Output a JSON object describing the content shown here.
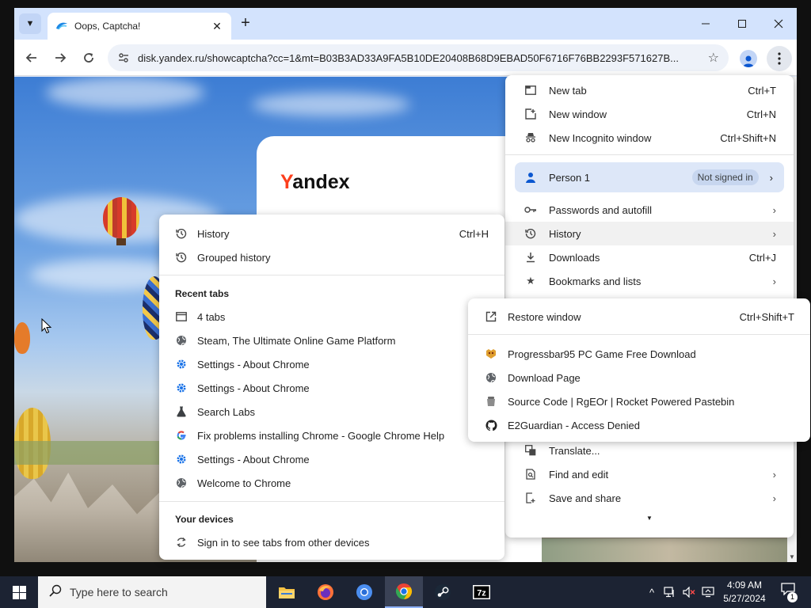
{
  "browser": {
    "tab_title": "Oops, Captcha!",
    "url": "disk.yandex.ru/showcaptcha?cc=1&mt=B03B3AD33A9FA5B10DE20408B68D9EBAD50F6716F76BB2293F571627B...",
    "close_glyph": "✕",
    "new_tab_glyph": "+"
  },
  "page": {
    "yandex_logo_y": "Y",
    "yandex_logo_rest": "andex"
  },
  "main_menu": {
    "new_tab": {
      "label": "New tab",
      "shortcut": "Ctrl+T"
    },
    "new_window": {
      "label": "New window",
      "shortcut": "Ctrl+N"
    },
    "new_incognito": {
      "label": "New Incognito window",
      "shortcut": "Ctrl+Shift+N"
    },
    "person": {
      "label": "Person 1",
      "badge": "Not signed in"
    },
    "passwords": {
      "label": "Passwords and autofill"
    },
    "history": {
      "label": "History"
    },
    "downloads": {
      "label": "Downloads",
      "shortcut": "Ctrl+J"
    },
    "bookmarks": {
      "label": "Bookmarks and lists"
    },
    "translate": {
      "label": "Translate..."
    },
    "find_edit": {
      "label": "Find and edit"
    },
    "save_share": {
      "label": "Save and share"
    }
  },
  "history_menu": {
    "history": {
      "label": "History",
      "shortcut": "Ctrl+H"
    },
    "grouped": {
      "label": "Grouped history"
    },
    "recent_tabs_heading": "Recent tabs",
    "recent_tabs": [
      {
        "label": "4 tabs",
        "icon": "window-icon"
      },
      {
        "label": "Steam, The Ultimate Online Game Platform",
        "icon": "globe-icon"
      },
      {
        "label": "Settings - About Chrome",
        "icon": "settings-icon"
      },
      {
        "label": "Settings - About Chrome",
        "icon": "settings-icon"
      },
      {
        "label": "Search Labs",
        "icon": "flask-icon"
      },
      {
        "label": "Fix problems installing Chrome - Google Chrome Help",
        "icon": "google-icon"
      },
      {
        "label": "Settings - About Chrome",
        "icon": "settings-icon"
      },
      {
        "label": "Welcome to Chrome",
        "icon": "globe-icon"
      }
    ],
    "your_devices_heading": "Your devices",
    "sign_in": {
      "label": "Sign in to see tabs from other devices"
    }
  },
  "tabs_menu": {
    "restore": {
      "label": "Restore window",
      "shortcut": "Ctrl+Shift+T"
    },
    "items": [
      {
        "label": "Progressbar95 PC Game Free Download",
        "icon": "game-favicon-icon"
      },
      {
        "label": "Download Page",
        "icon": "globe-icon"
      },
      {
        "label": "Source Code | RgEOr | Rocket Powered Pastebin",
        "icon": "pastebin-icon"
      },
      {
        "label": "E2Guardian - Access Denied",
        "icon": "github-icon"
      }
    ]
  },
  "taskbar": {
    "search_placeholder": "Type here to search",
    "time": "4:09 AM",
    "date": "5/27/2024",
    "notification_count": "1"
  },
  "colors": {
    "accent": "#0b57d0",
    "yandex_red": "#fc3f1d",
    "taskbar": "#1c2333"
  }
}
